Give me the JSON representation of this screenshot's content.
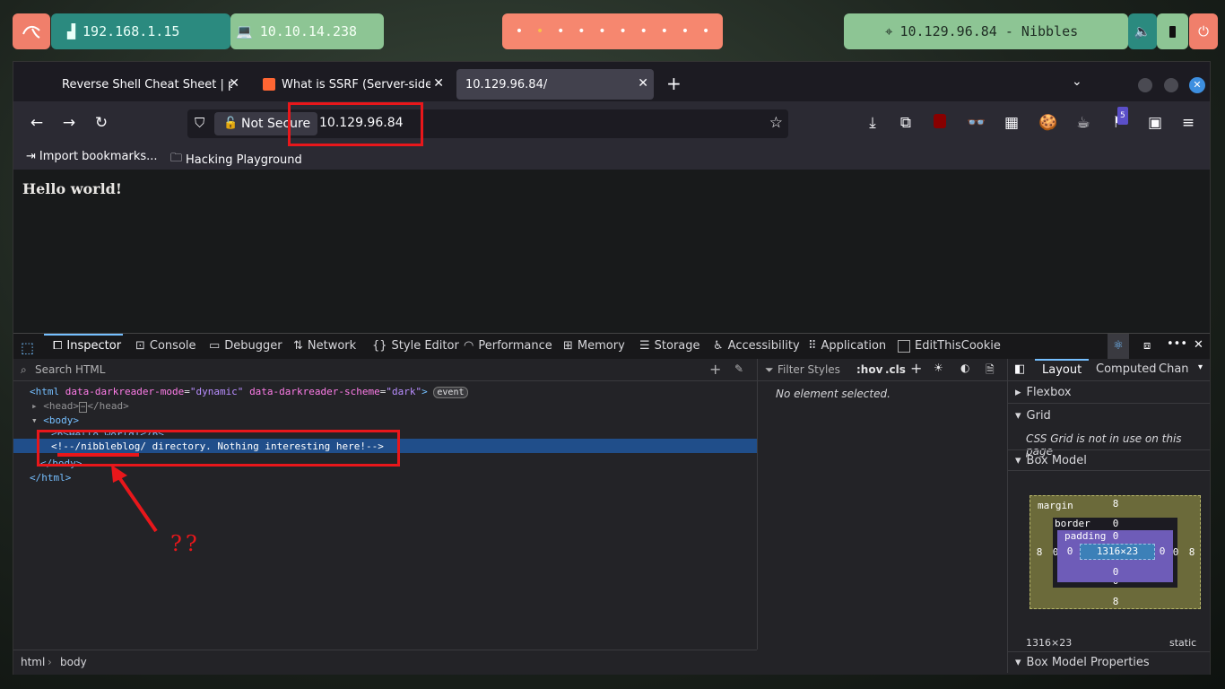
{
  "panel": {
    "ip_local": "192.168.1.15",
    "ip_vpn": "10.10.14.238",
    "target": "10.129.96.84 - Nibbles",
    "workspaces": [
      "•",
      "•",
      "•",
      "•",
      "•",
      "•",
      "•",
      "•",
      "•",
      "•"
    ]
  },
  "tabs": [
    {
      "label": "Reverse Shell Cheat Sheet | pe",
      "active": false
    },
    {
      "label": "What is SSRF (Server-side r",
      "active": false
    },
    {
      "label": "10.129.96.84/",
      "active": true
    }
  ],
  "new_tab": "+",
  "toolbar": {
    "not_secure": "Not Secure",
    "url": "10.129.96.84",
    "extension_badge": "5"
  },
  "bookmarks": [
    {
      "label": "Import bookmarks..."
    },
    {
      "label": "Hacking Playground"
    }
  ],
  "page": {
    "heading": "Hello world!"
  },
  "devtools": {
    "tabs": [
      "Inspector",
      "Console",
      "Debugger",
      "Network",
      "Style Editor",
      "Performance",
      "Memory",
      "Storage",
      "Accessibility",
      "Application",
      "EditThisCookie"
    ],
    "search_placeholder": "Search HTML",
    "filter_placeholder": "Filter Styles",
    "hov": ":hov",
    "cls": ".cls",
    "no_element": "No element selected.",
    "layout_tabs": [
      "Layout",
      "Computed",
      "Chan"
    ],
    "sections": [
      "Flexbox",
      "Grid",
      "Box Model",
      "Box Model Properties"
    ],
    "grid_note": "CSS Grid is not in use on this page",
    "markup": {
      "html_open_tag": "html",
      "attr1": "data-darkreader-mode",
      "val1": "\"dynamic\"",
      "attr2": "data-darkreader-scheme",
      "val2": "\"dark\"",
      "event_badge": "event",
      "head_line": "<head>",
      "head_close": "</head>",
      "body_open": "<body>",
      "b_line": "<b>Hello world!</b>",
      "comment": "<!--/nibbleblog/ directory. Nothing interesting here!-->",
      "body_close": "</body>",
      "html_close": "</html>"
    },
    "box_model": {
      "margin_label": "margin",
      "border_label": "border",
      "padding_label": "padding",
      "content": "1316×23",
      "margin_top": "8",
      "margin_bottom": "8",
      "margin_left": "8",
      "margin_right": "8",
      "border_top": "0",
      "border_bottom": "0",
      "border_left": "0",
      "border_right": "0",
      "padding_top": "0",
      "padding_bottom": "0",
      "padding_left": "0",
      "padding_right": "0",
      "size": "1316×23",
      "position": "static"
    },
    "breadcrumbs": [
      "html",
      "body"
    ]
  },
  "annotation": "??"
}
